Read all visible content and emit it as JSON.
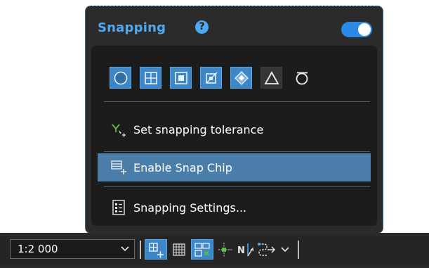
{
  "popup": {
    "title": "Snapping",
    "toggle_state": "on",
    "accent_color": "#4fa8f0",
    "snap_types": [
      {
        "icon": "point-snap-icon",
        "state": "on"
      },
      {
        "icon": "vertex-snap-icon",
        "state": "on"
      },
      {
        "icon": "edge-snap-icon",
        "state": "on"
      },
      {
        "icon": "end-snap-icon",
        "state": "on"
      },
      {
        "icon": "intersection-snap-icon",
        "state": "on"
      },
      {
        "icon": "midpoint-snap-icon",
        "state": "off"
      },
      {
        "icon": "tangent-snap-icon",
        "state": "off"
      }
    ],
    "menu": {
      "tolerance_label": "Set snapping tolerance",
      "snap_chip_label": "Enable Snap Chip",
      "settings_label": "Snapping Settings..."
    }
  },
  "toolbar": {
    "scale_value": "1:2 000",
    "icons": [
      "snapping-icon",
      "grid-icon",
      "correction-icon",
      "constraints-icon",
      "north-arrow-icon",
      "auto-trace-icon",
      "more-dropdown-icon"
    ]
  }
}
